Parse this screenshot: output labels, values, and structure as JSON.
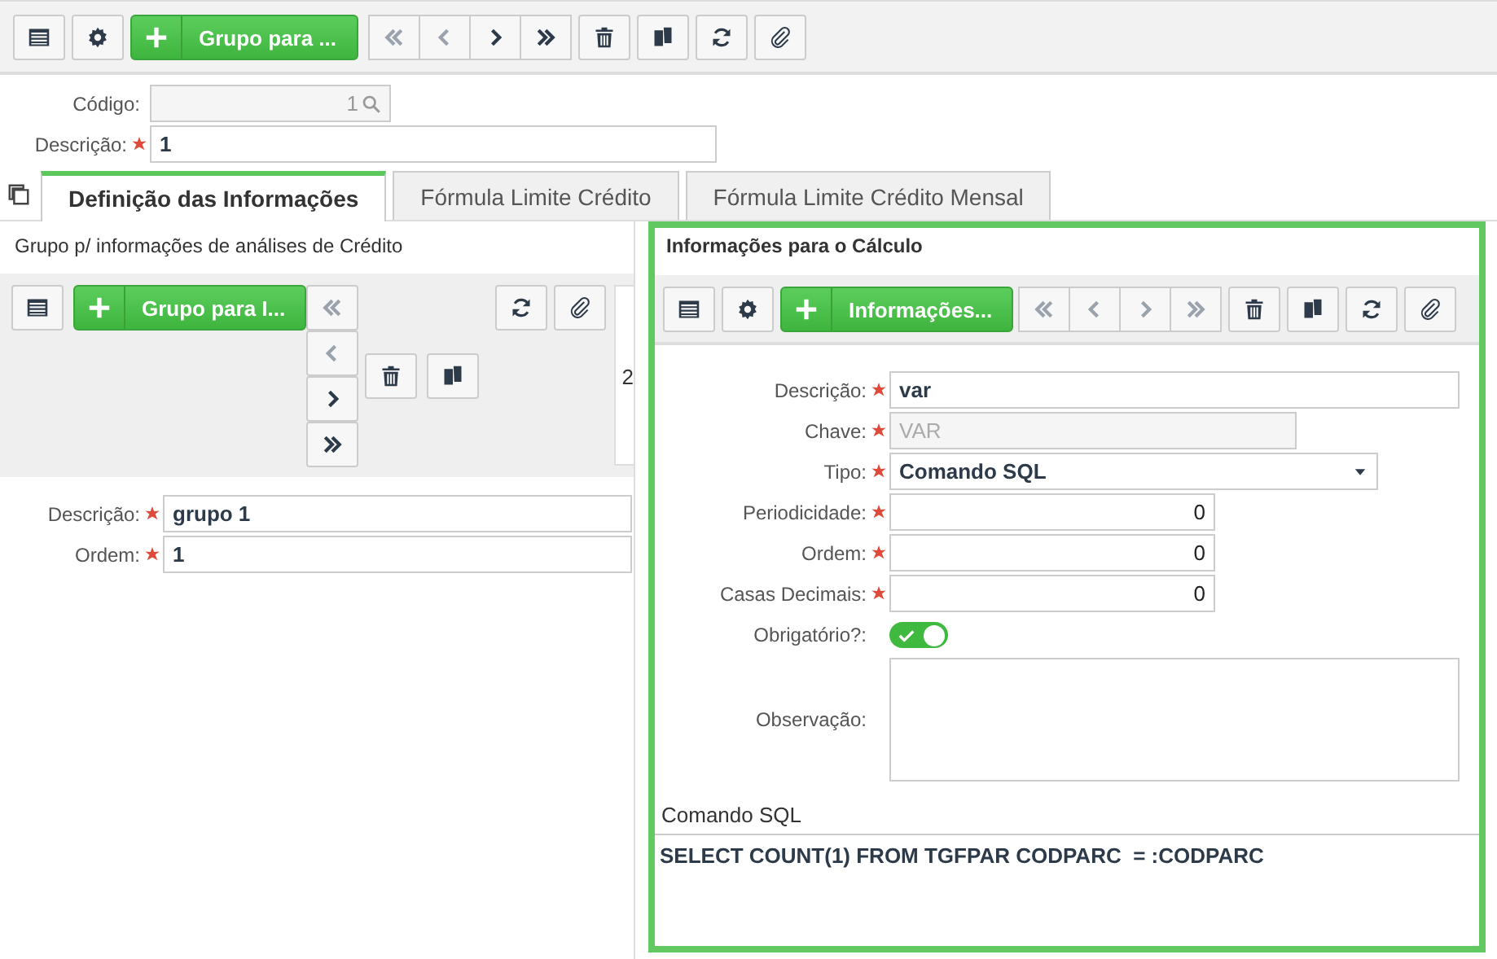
{
  "toolbar": {
    "add_button": "Grupo para ...",
    "nav": [
      {
        "disabled": true
      },
      {
        "disabled": true
      },
      {
        "disabled": false
      },
      {
        "disabled": false
      }
    ]
  },
  "header_form": {
    "codigo": {
      "label": "Código:",
      "value": "1"
    },
    "descricao": {
      "label": "Descrição:",
      "value": "1",
      "required": true
    }
  },
  "tabs": [
    {
      "label": "Definição das Informações",
      "selected": true
    },
    {
      "label": "Fórmula Limite Crédito",
      "selected": false
    },
    {
      "label": "Fórmula Limite Crédito Mensal",
      "selected": false
    }
  ],
  "left_panel": {
    "title": "Grupo p/ informações de análises de Crédito",
    "add_button": "Grupo para I...",
    "nav": [
      {
        "disabled": true
      },
      {
        "disabled": true
      },
      {
        "disabled": false
      },
      {
        "disabled": false
      }
    ],
    "record_card": "2",
    "fields": [
      {
        "label": "Descrição:",
        "value": "grupo 1",
        "required": true
      },
      {
        "label": "Ordem:",
        "value": "1",
        "required": true
      }
    ]
  },
  "right_panel": {
    "title": "Informações para o Cálculo",
    "add_button": "Informações...",
    "nav": [
      {
        "disabled": true
      },
      {
        "disabled": true
      },
      {
        "disabled": true
      },
      {
        "disabled": true
      }
    ],
    "fields": [
      {
        "kind": "text",
        "label": "Descrição:",
        "value": "var",
        "required": true,
        "disabled": false
      },
      {
        "kind": "text",
        "label": "Chave:",
        "value": "VAR",
        "required": true,
        "disabled": true
      },
      {
        "kind": "select",
        "label": "Tipo:",
        "value": "Comando SQL",
        "required": true
      },
      {
        "kind": "number",
        "label": "Periodicidade:",
        "value": "0",
        "required": true
      },
      {
        "kind": "number",
        "label": "Ordem:",
        "value": "0",
        "required": true
      },
      {
        "kind": "number",
        "label": "Casas Decimais:",
        "value": "0",
        "required": true
      },
      {
        "kind": "toggle",
        "label": "Obrigatório?:",
        "on": true
      },
      {
        "kind": "textarea",
        "label": "Observação:"
      }
    ],
    "sql": {
      "label": "Comando SQL",
      "value": "SELECT COUNT(1) FROM TGFPAR CODPARC  = :CODPARC"
    }
  }
}
